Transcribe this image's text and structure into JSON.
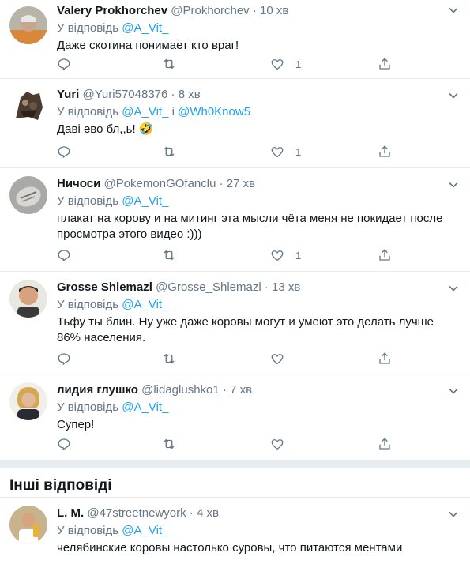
{
  "tweets": [
    {
      "name": "Valery Prokhorchev",
      "handle": "@Prokhorchev",
      "dot": "·",
      "time": "10 хв",
      "reply_prefix": "У відповідь",
      "reply_mention": "@A_Vit_",
      "reply_extra": "",
      "text": "Даже скотина понимает кто враг!",
      "like_count": "1"
    },
    {
      "name": "Yuri",
      "handle": "@Yuri57048376",
      "dot": "·",
      "time": "8 хв",
      "reply_prefix": "У відповідь",
      "reply_mention": "@A_Vit_",
      "reply_and": "і",
      "reply_mention2": "@Wh0Know5",
      "text": "Даві ево бл,,ь! 🤣",
      "like_count": "1"
    },
    {
      "name": "Ничоси",
      "handle": "@PokemonGOfanclu",
      "dot": "·",
      "time": "27 хв",
      "reply_prefix": "У відповідь",
      "reply_mention": "@A_Vit_",
      "text": "плакат на корову и на митинг эта мысли чёта меня не покидает после просмотра этого видео :)))",
      "like_count": "1"
    },
    {
      "name": "Grosse Shlemazl",
      "handle": "@Grosse_Shlemazl",
      "dot": "·",
      "time": "13 хв",
      "reply_prefix": "У відповідь",
      "reply_mention": "@A_Vit_",
      "text": "Тьфу ты блин. Ну уже даже коровы могут и умеют это делать лучше 86% населения.",
      "like_count": ""
    },
    {
      "name": "лидия глушко",
      "handle": "@lidaglushko1",
      "dot": "·",
      "time": "7 хв",
      "reply_prefix": "У відповідь",
      "reply_mention": "@A_Vit_",
      "text": "Супер!",
      "like_count": ""
    }
  ],
  "section_title": "Інші відповіді",
  "other": {
    "name": "L. M.",
    "handle": "@47streetnewyork",
    "dot": "·",
    "time": "4 хв",
    "reply_prefix": "У відповідь",
    "reply_mention": "@A_Vit_",
    "text": "челябинские коровы настолько суровы, что питаются ментами"
  },
  "colors": {
    "accent": "#1da1f2",
    "secondary_text": "#657786",
    "border": "#e6ecf0"
  },
  "icons": [
    "reply-icon",
    "retweet-icon",
    "like-icon",
    "share-icon",
    "caret-down-icon"
  ]
}
